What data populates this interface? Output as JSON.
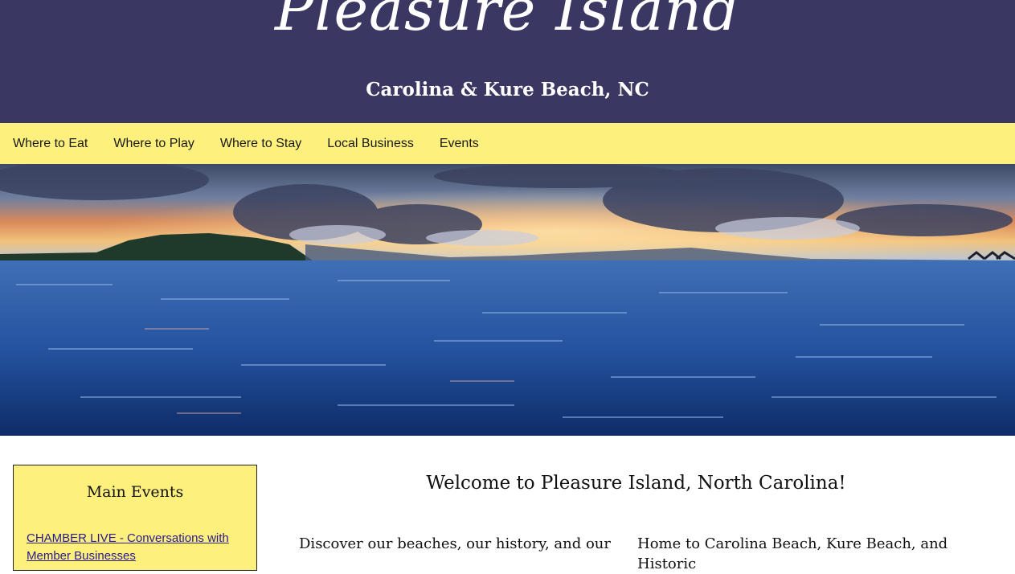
{
  "header": {
    "logo_text": "Pleasure Island",
    "subtitle": "Carolina & Kure Beach, NC"
  },
  "nav": {
    "items": [
      {
        "label": "Where to Eat"
      },
      {
        "label": "Where to Play"
      },
      {
        "label": "Where to Stay"
      },
      {
        "label": "Local Business"
      },
      {
        "label": "Events"
      }
    ]
  },
  "hero": {
    "alt": "Island sunset over the ocean"
  },
  "sidebar": {
    "title": "Main Events",
    "event_link": "CHAMBER LIVE - Conversations with Member Businesses"
  },
  "main": {
    "welcome_title": "Welcome to Pleasure Island, North Carolina!",
    "col_left": "Discover our beaches, our history, and our",
    "col_right": "Home to Carolina Beach, Kure Beach, and Historic"
  },
  "colors": {
    "header_bg": "#3a3762",
    "nav_bg": "#fdf07c",
    "link": "#2a1a8c"
  }
}
